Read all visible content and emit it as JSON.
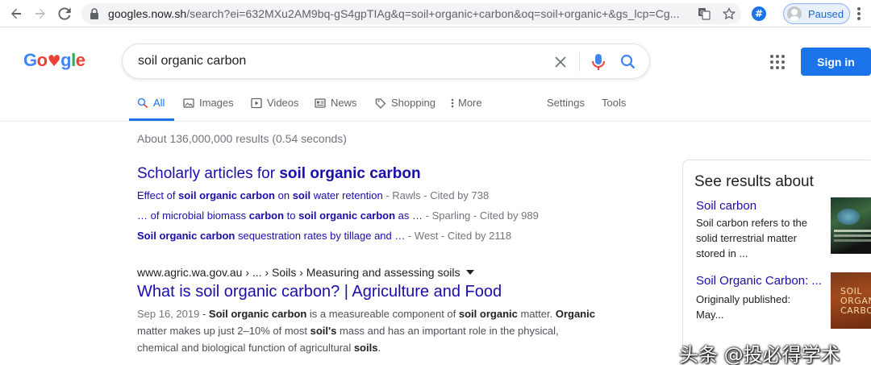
{
  "browser": {
    "url_host": "googles.now.sh",
    "url_rest": "/search?ei=632MXu2AM9bq-gS4gpTIAg&q=soil+organic+carbon&oq=soil+organic+&gs_lcp=Cg...",
    "profile_status": "Paused"
  },
  "logo": {
    "letters": [
      "G",
      "o",
      "♥",
      "g",
      "l",
      "e"
    ]
  },
  "search": {
    "query": "soil organic carbon"
  },
  "header": {
    "sign_in": "Sign in"
  },
  "tabs": {
    "all": "All",
    "images": "Images",
    "videos": "Videos",
    "news": "News",
    "shopping": "Shopping",
    "more": "More",
    "settings": "Settings",
    "tools": "Tools"
  },
  "stats": "About 136,000,000 results (0.54 seconds)",
  "scholarly": {
    "title_prefix": "Scholarly articles for ",
    "title_bold": "soil organic carbon",
    "items": [
      {
        "parts": [
          "Effect of ",
          "soil organic carbon",
          " on ",
          "soil",
          " water retention"
        ],
        "meta": " - Rawls - Cited by 738"
      },
      {
        "parts": [
          "… of microbial biomass ",
          "carbon",
          " to ",
          "soil organic carbon",
          " as …"
        ],
        "meta": " - Sparling - Cited by 989"
      },
      {
        "parts": [
          "Soil organic carbon",
          " sequestration rates by tillage and …"
        ],
        "meta": " - West - Cited by 2118"
      }
    ]
  },
  "result": {
    "cite": "www.agric.wa.gov.au › ... › Soils › Measuring and assessing soils",
    "title": "What is soil organic carbon? | Agriculture and Food",
    "date": "Sep 16, 2019",
    "dash": " - ",
    "snippet_parts": [
      "Soil organic carbon",
      " is a measureable component of ",
      "soil organic",
      " matter. ",
      "Organic",
      " matter makes up just 2–10% of most ",
      "soil's",
      " mass and has an important role in the physical, chemical and biological function of agricultural ",
      "soils",
      "."
    ]
  },
  "panel": {
    "heading": "See results about",
    "items": [
      {
        "title": "Soil carbon",
        "desc": "Soil carbon refers to the solid terrestrial matter stored in ..."
      },
      {
        "title": "Soil Organic Carbon: ...",
        "desc": "Originally published: May..."
      }
    ],
    "thumb2_text": "SOIL ORGANIC CARBON"
  },
  "watermark": "头条 @投必得学术",
  "colors": {
    "link": "#1a0dab",
    "accent": "#1a73e8",
    "logo": [
      "#4285f4",
      "#ea4335",
      "#ea4335",
      "#4285f4",
      "#34a853",
      "#ea4335"
    ]
  }
}
